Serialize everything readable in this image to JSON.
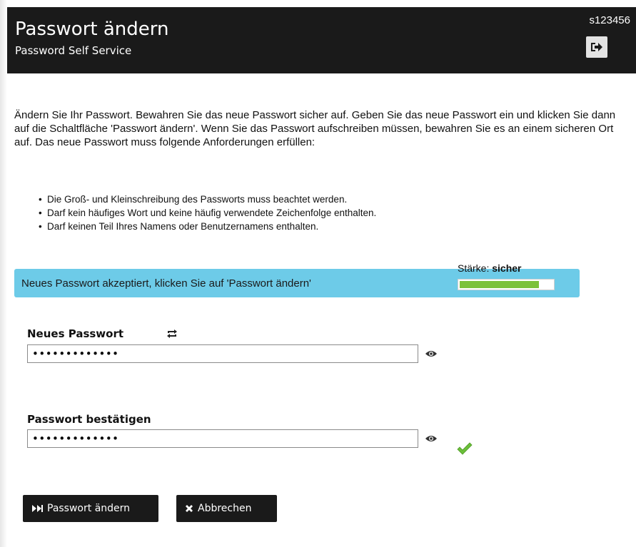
{
  "header": {
    "title": "Passwort ändern",
    "subtitle": "Password Self Service",
    "user_id": "s123456",
    "logout_icon": "logout-icon"
  },
  "intro": {
    "text": "Ändern Sie Ihr Passwort. Bewahren Sie das neue Passwort sicher auf. Geben Sie das neue Passwort ein und klicken Sie dann auf die Schaltfläche 'Passwort ändern'. Wenn Sie das Passwort aufschreiben müssen, bewahren Sie es an einem sicheren Ort auf. Das neue Passwort muss folgende Anforderungen erfüllen:"
  },
  "requirements": [
    "Die Groß- und Kleinschreibung des Passworts muss beachtet werden.",
    "Darf kein häufiges Wort und keine häufig verwendete Zeichenfolge enthalten.",
    "Darf keinen Teil Ihres Namens oder Benutzernamens enthalten."
  ],
  "status": {
    "message": "Neues Passwort akzeptiert, klicken Sie auf 'Passwort ändern'",
    "color": "#6dcbe8"
  },
  "new_password": {
    "label": "Neues Passwort",
    "value": "•••••••••••••",
    "regenerate_icon": "refresh-icon",
    "show_icon": "eye-icon"
  },
  "strength": {
    "label": "Stärke:",
    "value": "sicher",
    "level": 0.85,
    "color": "#7cc23a"
  },
  "confirm_password": {
    "label": "Passwort bestätigen",
    "value": "•••••••••••••",
    "show_icon": "eye-icon",
    "match_icon": "checkmark-icon"
  },
  "actions": {
    "submit_label": "Passwort ändern",
    "submit_icon": "fast-forward-icon",
    "cancel_label": "Abbrechen",
    "cancel_icon": "close-icon"
  }
}
